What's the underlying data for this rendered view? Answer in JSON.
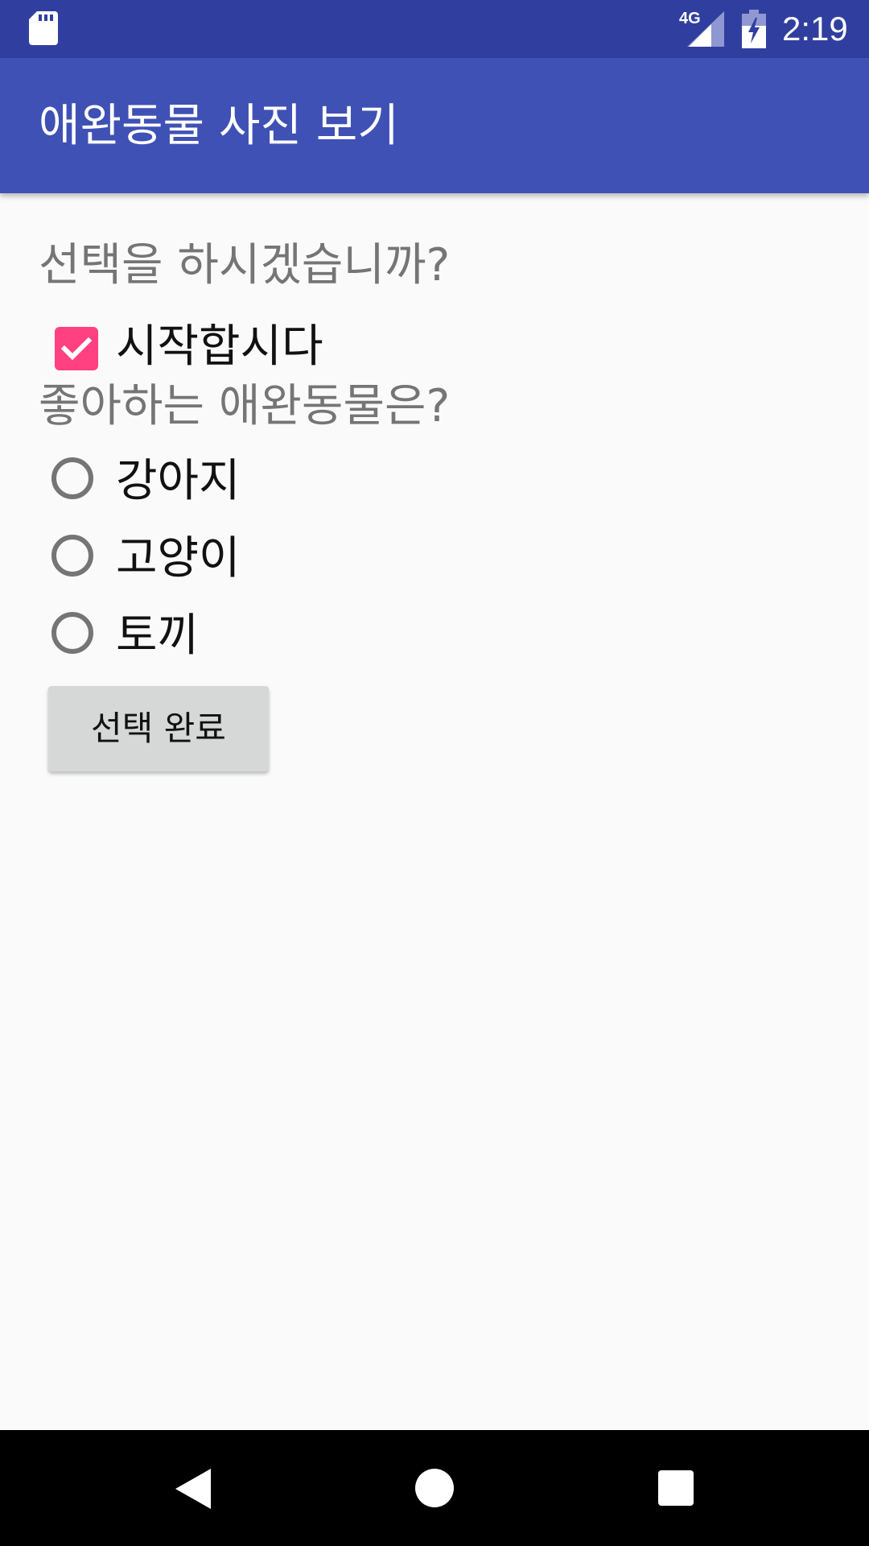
{
  "status_bar": {
    "time": "2:19",
    "network": "4G",
    "icons": [
      "sd-card-icon",
      "signal-icon",
      "battery-charging-icon"
    ]
  },
  "app_bar": {
    "title": "애완동물 사진 보기"
  },
  "main": {
    "question_start": "선택을 하시겠습니까?",
    "start_checkbox": {
      "label": "시작합시다",
      "checked": true
    },
    "question_pet": "좋아하는 애완동물은?",
    "pet_options": [
      {
        "label": "강아지",
        "selected": false
      },
      {
        "label": "고양이",
        "selected": false
      },
      {
        "label": "토끼",
        "selected": false
      }
    ],
    "done_button_label": "선택 완료"
  },
  "nav_bar": {
    "icons": [
      "back-icon",
      "home-icon",
      "recents-icon"
    ]
  },
  "colors": {
    "status_bar": "#303F9F",
    "app_bar": "#3F51B5",
    "accent": "#FF4081",
    "background": "#FAFAFA",
    "button": "#D6D7D7"
  }
}
